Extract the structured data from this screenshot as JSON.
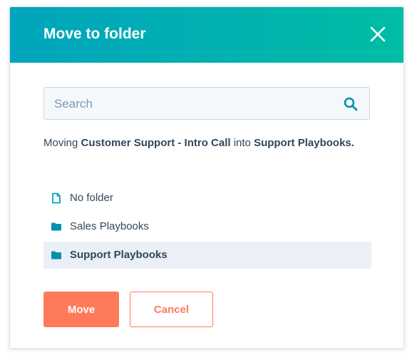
{
  "dialog": {
    "title": "Move to folder",
    "close_icon": "close-icon"
  },
  "search": {
    "placeholder": "Search",
    "value": "",
    "icon": "search-icon"
  },
  "message": {
    "prefix": "Moving ",
    "item_name": "Customer Support - Intro Call",
    "middle": " into ",
    "target_folder": "Support Playbooks",
    "suffix": "."
  },
  "folders": [
    {
      "label": "No folder",
      "icon": "document-icon",
      "selected": false
    },
    {
      "label": "Sales Playbooks",
      "icon": "folder-icon",
      "selected": false
    },
    {
      "label": "Support Playbooks",
      "icon": "folder-icon",
      "selected": true
    }
  ],
  "actions": {
    "move_label": "Move",
    "cancel_label": "Cancel"
  },
  "colors": {
    "header_gradient_start": "#00a4bd",
    "header_gradient_end": "#00bda5",
    "primary": "#ff7a59",
    "text": "#33475b",
    "icon_teal": "#00a4bd",
    "icon_folder": "#0091ae",
    "selected_row": "#eaf0f6"
  }
}
